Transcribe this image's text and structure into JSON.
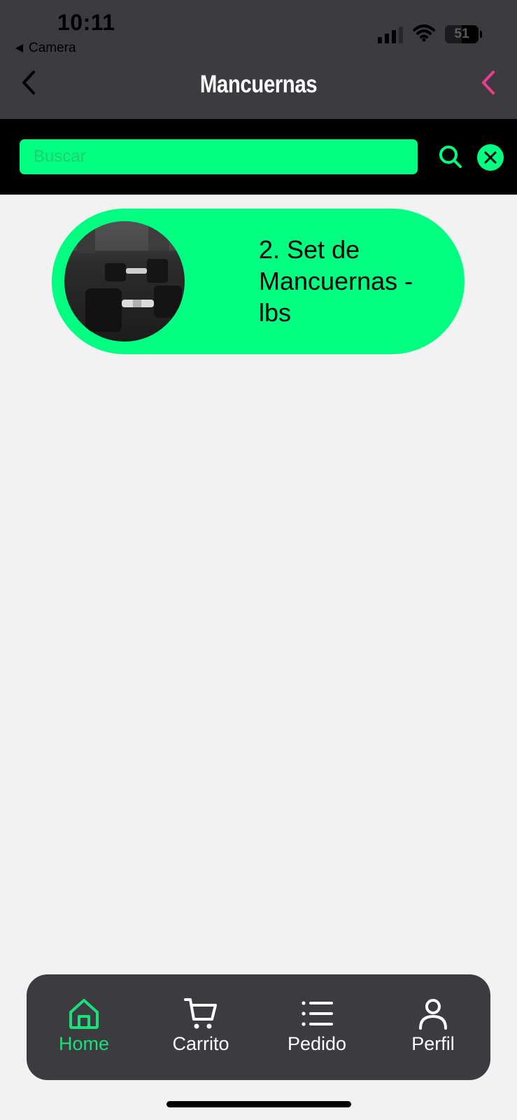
{
  "status_bar": {
    "time": "10:11",
    "back_app": "Camera",
    "battery_level": "51",
    "battery_fraction": 0.51,
    "signal_icon": "cellular-signal-icon",
    "wifi_icon": "wifi-icon"
  },
  "header": {
    "title": "Mancuernas",
    "back_icon": "chevron-left-icon",
    "accent_back_icon": "chevron-left-icon",
    "bg_color": "#3c3b40",
    "accent_color": "#ec3d8c"
  },
  "search": {
    "placeholder": "Buscar",
    "value": "",
    "search_icon": "search-icon",
    "clear_icon": "close-icon",
    "accent_color": "#00ff80"
  },
  "products": [
    {
      "name": "2. Set de Mancuernas - lbs",
      "image": "dumbbells-photo"
    }
  ],
  "tab_bar": {
    "items": [
      {
        "label": "Home",
        "icon": "home-icon",
        "active": true
      },
      {
        "label": "Carrito",
        "icon": "cart-icon",
        "active": false
      },
      {
        "label": "Pedido",
        "icon": "list-icon",
        "active": false
      },
      {
        "label": "Perfil",
        "icon": "user-icon",
        "active": false
      }
    ],
    "active_color": "#18e07c"
  }
}
